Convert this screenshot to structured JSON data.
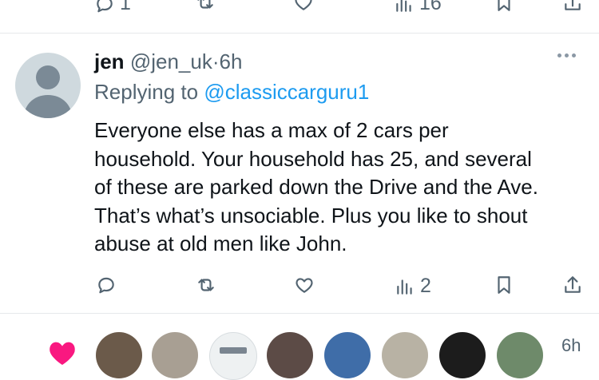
{
  "top_actions": {
    "reply_count": "1",
    "views_count": "16"
  },
  "tweet": {
    "name": "jen",
    "handle": "@jen_uk",
    "separator": "·",
    "time": "6h",
    "replying_prefix": "Replying to ",
    "replying_to": "@classiccarguru1",
    "text": "Everyone else has a max of 2 cars per\nhousehold. Your household has 25, and several\nof these are parked down the Drive and the Ave.\nThat’s what’s unsociable. Plus you like to shout\nabuse at old men like John.",
    "actions": {
      "reply_count": "",
      "retweet_count": "",
      "like_count": "",
      "views_count": "2"
    }
  },
  "bottom_strip": {
    "time": "6h"
  },
  "colors": {
    "text": "#0f1419",
    "secondary": "#536471",
    "link": "#1d9bf0",
    "avatar_placeholder": "#cfd9de",
    "divider": "#e6e9eb",
    "like_pink": "#f91880"
  },
  "icons": [
    "reply-icon",
    "retweet-icon",
    "heart-icon",
    "views-icon",
    "bookmark-icon",
    "share-icon",
    "more-icon"
  ]
}
